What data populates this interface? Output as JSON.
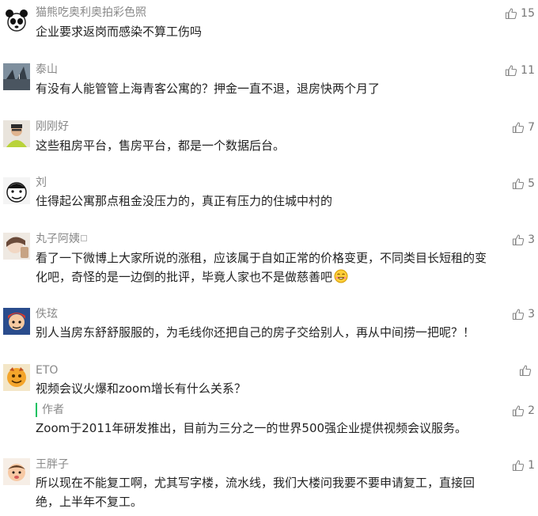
{
  "comments": [
    {
      "name": "猫熊吃奥利奥拍彩色照",
      "likes": "15",
      "text": "企业要求返岗而感染不算工伤吗"
    },
    {
      "name": "泰山",
      "likes": "11",
      "text": "有没有人能管管上海青客公寓的？押金一直不退，退房快两个月了"
    },
    {
      "name": "刚刚好",
      "likes": "7",
      "text": "这些租房平台，售房平台，都是一个数据后台。"
    },
    {
      "name": "刘",
      "likes": "5",
      "text": "住得起公寓那点租金没压力的，真正有压力的住城中村的"
    },
    {
      "name": "丸子阿姨",
      "likes": "3",
      "text_line1": "看了一下微博上大家所说的涨租，应该属于自如正常的价格变更，不同类目长短租的变",
      "text_line2": "化吧，奇怪的是一边倒的批评，毕竟人家也不是做慈善吧"
    },
    {
      "name": "佚玹",
      "likes": "3",
      "text": "别人当房东舒舒服服的，为毛线你还把自己的房子交给别人，再从中间捞一把呢？！"
    },
    {
      "name": "ETO",
      "likes": "",
      "text": "视频会议火爆和zoom增长有什么关系？",
      "reply": {
        "label": "作者",
        "likes": "2",
        "text": "Zoom于2011年研发推出，目前为三分之一的世界500强企业提供视频会议服务。"
      }
    },
    {
      "name": "王胖子",
      "likes": "1",
      "text_line1": "所以现在不能复工啊，尤其写字楼，流水线，我们大楼问我要不要申请复工，直接回",
      "text_line2": "绝，上半年不复工。"
    }
  ],
  "colors": {
    "name": "#888888",
    "text": "#222222",
    "accent": "#07c160"
  },
  "icons": {
    "like": "thumbs-up-icon"
  }
}
